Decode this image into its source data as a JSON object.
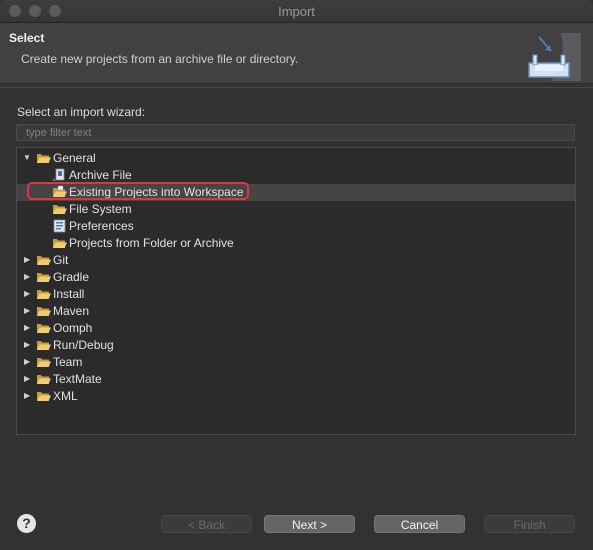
{
  "window": {
    "title": "Import"
  },
  "header": {
    "title": "Select",
    "description": "Create new projects from an archive file or directory."
  },
  "wizard": {
    "label": "Select an import wizard:",
    "filter_placeholder": "type filter text"
  },
  "tree": {
    "general": {
      "label": "General",
      "children": [
        "Archive File",
        "Existing Projects into Workspace",
        "File System",
        "Preferences",
        "Projects from Folder or Archive"
      ]
    },
    "categories": [
      "Git",
      "Gradle",
      "Install",
      "Maven",
      "Oomph",
      "Run/Debug",
      "Team",
      "TextMate",
      "XML"
    ],
    "selected": "Existing Projects into Workspace"
  },
  "buttons": {
    "help": "?",
    "back": "< Back",
    "next": "Next >",
    "cancel": "Cancel",
    "finish": "Finish"
  },
  "colors": {
    "highlight": "#e0343e",
    "folder": "#e8c15e",
    "selection": "#454545"
  }
}
